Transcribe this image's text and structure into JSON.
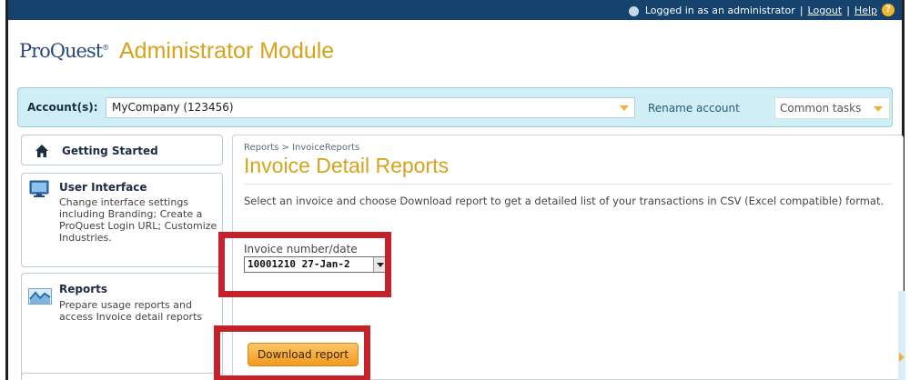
{
  "topbar": {
    "logged_in_text": "Logged in as an administrator",
    "logout_label": "Logout",
    "help_label": "Help",
    "separator": "|",
    "background_color": "#16426e"
  },
  "header": {
    "logo_text": "ProQuest",
    "app_title": "Administrator Module",
    "title_color": "#d7a31d"
  },
  "account_bar": {
    "label": "Account(s):",
    "selected_account": "MyCompany (123456)",
    "rename_label": "Rename account",
    "common_tasks_label": "Common tasks"
  },
  "sidebar": {
    "items": [
      {
        "title": "Getting Started",
        "icon": "home-icon"
      },
      {
        "title": "User Interface",
        "description": "Change interface settings including Branding; Create a ProQuest Login URL; Customize Industries.",
        "icon": "monitor-icon"
      },
      {
        "title": "Reports",
        "description": "Prepare usage reports and access Invoice detail reports",
        "icon": "reports-icon"
      }
    ]
  },
  "main": {
    "breadcrumb": "Reports > InvoiceReports",
    "page_title": "Invoice Detail Reports",
    "instructions": "Select an invoice and choose Download report to get a detailed list of your transactions in CSV (Excel compatible) format.",
    "invoice_label": "Invoice number/date",
    "invoice_selected": "10001210 27-Jan-2",
    "download_label": "Download report"
  },
  "colors": {
    "highlight": "#c3222b",
    "account_bar_bg": "#cfeef5",
    "button_orange": "#f29a1c"
  }
}
